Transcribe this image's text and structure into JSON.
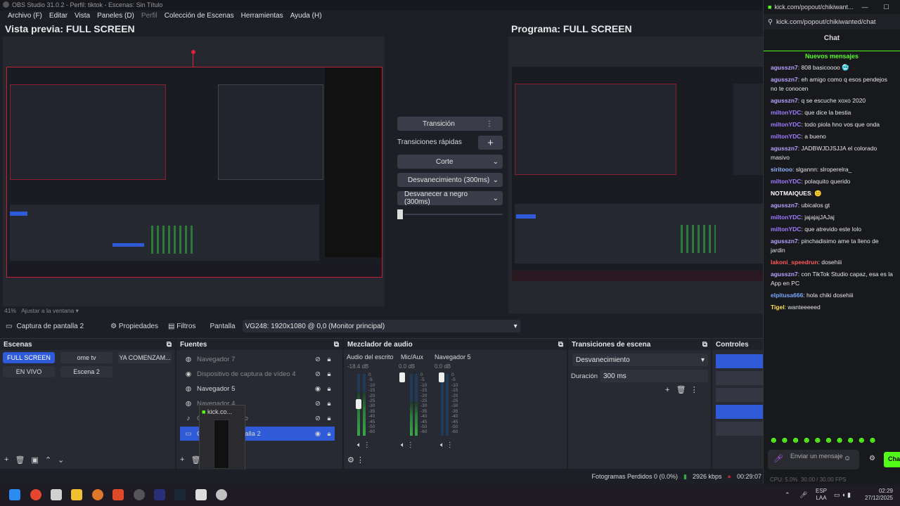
{
  "window_title": "OBS Studio 31.0.2 - Perfil: tiktok - Escenas: Sin Título",
  "menu": [
    {
      "label": "Archivo (F)",
      "dim": false
    },
    {
      "label": "Editar",
      "dim": false
    },
    {
      "label": "Vista",
      "dim": false
    },
    {
      "label": "Paneles (D)",
      "dim": false
    },
    {
      "label": "Perfil",
      "dim": true
    },
    {
      "label": "Colección de Escenas",
      "dim": false
    },
    {
      "label": "Herramientas",
      "dim": false
    },
    {
      "label": "Ayuda (H)",
      "dim": false
    }
  ],
  "preview": {
    "title": "Vista previa: FULL SCREEN",
    "zoom": "41%",
    "fit": "Ajustar a la ventana"
  },
  "program": {
    "title": "Programa: FULL SCREEN"
  },
  "transition_panel": {
    "transition_btn": "Transición",
    "quick_label": "Transiciones rápidas",
    "items": [
      "Corte",
      "Desvanecimiento (300ms)",
      "Desvanecer a negro (300ms)"
    ]
  },
  "source_bar": {
    "source_name": "Captura de pantalla 2",
    "properties": "Propiedades",
    "filters": "Filtros",
    "screen_label": "Pantalla",
    "screen_value": "VG248: 1920x1080 @ 0,0 (Monitor principal)"
  },
  "scenes": {
    "title": "Escenas",
    "items": [
      {
        "label": "FULL SCREEN",
        "selected": true
      },
      {
        "label": "ome tv",
        "selected": false
      },
      {
        "label": "YA COMENZAM...",
        "selected": false
      },
      {
        "label": "EN VIVO",
        "selected": false
      },
      {
        "label": "Escena 2",
        "selected": false
      }
    ]
  },
  "sources": {
    "title": "Fuentes",
    "items": [
      {
        "label": "Navegador 7",
        "visible": false,
        "selected": false
      },
      {
        "label": "Dispositivo de captura de vídeo 4",
        "visible": false,
        "selected": false
      },
      {
        "label": "Navegador 5",
        "visible": true,
        "selected": false
      },
      {
        "label": "Navegador 4",
        "visible": false,
        "selected": false
      },
      {
        "label": "Captura de audio",
        "visible": false,
        "selected": false
      },
      {
        "label": "Captura de pantalla 2",
        "visible": true,
        "selected": true
      }
    ],
    "drag_tooltip": "kick.co..."
  },
  "mixer": {
    "title": "Mezclador de audio",
    "channels": [
      {
        "name": "Audio del escrito",
        "db": "-18.4 dB",
        "level": 0.7
      },
      {
        "name": "Mic/Aux",
        "db": "0.0 dB",
        "level": 0.55
      },
      {
        "name": "Navegador 5",
        "db": "0.0 dB",
        "level": 0.0
      }
    ],
    "scale": [
      "0",
      "-5",
      "-10",
      "-15",
      "-20",
      "-25",
      "-30",
      "-35",
      "-40",
      "-45",
      "-50",
      "-60"
    ]
  },
  "scene_transitions": {
    "title": "Transiciones de escena",
    "selected": "Desvanecimiento",
    "duration_label": "Duración",
    "duration_value": "300 ms"
  },
  "controls": {
    "title": "Controles"
  },
  "status": {
    "dropped": "Fotogramas Perdidos 0 (0.0%)",
    "bitrate": "2926 kbps",
    "time": "00:29:07"
  },
  "chat": {
    "tab_title": "kick.com/popout/chikiwant...",
    "url": "kick.com/popout/chikiwanted/chat",
    "header": "Chat",
    "new_messages": "Nuevos mensajes",
    "messages": [
      {
        "user": "agusszn7",
        "color": "#b9a3ff",
        "text": "808 basicoooo 🥶"
      },
      {
        "user": "agusszn7",
        "color": "#b9a3ff",
        "text": "eh amigo como q esos pendejos no te conocen"
      },
      {
        "user": "agusszn7",
        "color": "#b9a3ff",
        "text": "q se escuche xoxo 2020"
      },
      {
        "user": "miltonYDC",
        "color": "#9f7bff",
        "text": "que dice la bestia"
      },
      {
        "user": "miltonYDC",
        "color": "#9f7bff",
        "text": "todo piola hno vos que onda"
      },
      {
        "user": "miltonYDC",
        "color": "#9f7bff",
        "text": "a bueno"
      },
      {
        "user": "agusszn7",
        "color": "#b9a3ff",
        "text": "JADBWJDJSJJA el colorado masivo"
      },
      {
        "user": "siritooo",
        "color": "#8fb8ff",
        "text": "slgannn: slroperelra_"
      },
      {
        "user": "miltonYDC",
        "color": "#9f7bff",
        "text": "polaquito querido"
      },
      {
        "user": "NOTMAIQUES",
        "color": "#ffffff",
        "text": "🙂"
      },
      {
        "user": "agusszn7",
        "color": "#b9a3ff",
        "text": "ubicalos gt"
      },
      {
        "user": "miltonYDC",
        "color": "#9f7bff",
        "text": "jajajajJAJaj"
      },
      {
        "user": "miltonYDC",
        "color": "#9f7bff",
        "text": "que atrevido este lolo"
      },
      {
        "user": "agusszn7",
        "color": "#b9a3ff",
        "text": "pinchadisimo ame ta lleno de jardin"
      },
      {
        "user": "lakoni_speedrun",
        "color": "#ff5a5a",
        "text": "dosehiii"
      },
      {
        "user": "agusszn7",
        "color": "#b9a3ff",
        "text": "con TikTok Studio capaz, esa es la App en PC"
      },
      {
        "user": "elpitusa666",
        "color": "#7aa8ff",
        "text": "hola chiki dosehiii"
      },
      {
        "user": "Tigel",
        "color": "#ffe14d",
        "text": "wanteeeeed"
      }
    ],
    "input_placeholder": "Enviar un mensaje",
    "send_label": "Chat"
  },
  "tray": {
    "lang1": "ESP",
    "lang2": "LAA",
    "time": "02:29",
    "date": "27/12/2025",
    "cpu": "CPU: 5.0%",
    "fps": "30.00 / 30.00 FPS"
  }
}
